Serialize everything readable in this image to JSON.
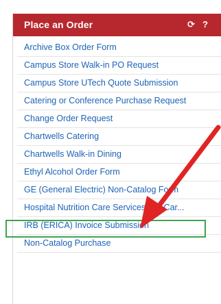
{
  "panel": {
    "title": "Place an Order",
    "refresh_icon_glyph": "⟳",
    "help_icon_glyph": "?"
  },
  "items": [
    {
      "label": "Archive Box Order Form"
    },
    {
      "label": "Campus Store Walk-in PO Request"
    },
    {
      "label": "Campus Store UTech Quote Submission"
    },
    {
      "label": "Catering or Conference Purchase Request"
    },
    {
      "label": "Change Order Request"
    },
    {
      "label": "Chartwells Catering"
    },
    {
      "label": "Chartwells Walk-in Dining"
    },
    {
      "label": "Ethyl Alcohol Order Form"
    },
    {
      "label": "GE (General Electric) Non-Catalog Form"
    },
    {
      "label": "Hospital Nutrition Care Services Gift Car..."
    },
    {
      "label": "IRB (ERICA) Invoice Submission"
    },
    {
      "label": "Non-Catalog Purchase"
    }
  ],
  "colors": {
    "header_bg": "#b7282e",
    "link": "#1d63b5",
    "highlight_border": "#3fa34d",
    "arrow": "#e02424"
  },
  "annotation": {
    "highlighted_item_index": 9
  }
}
